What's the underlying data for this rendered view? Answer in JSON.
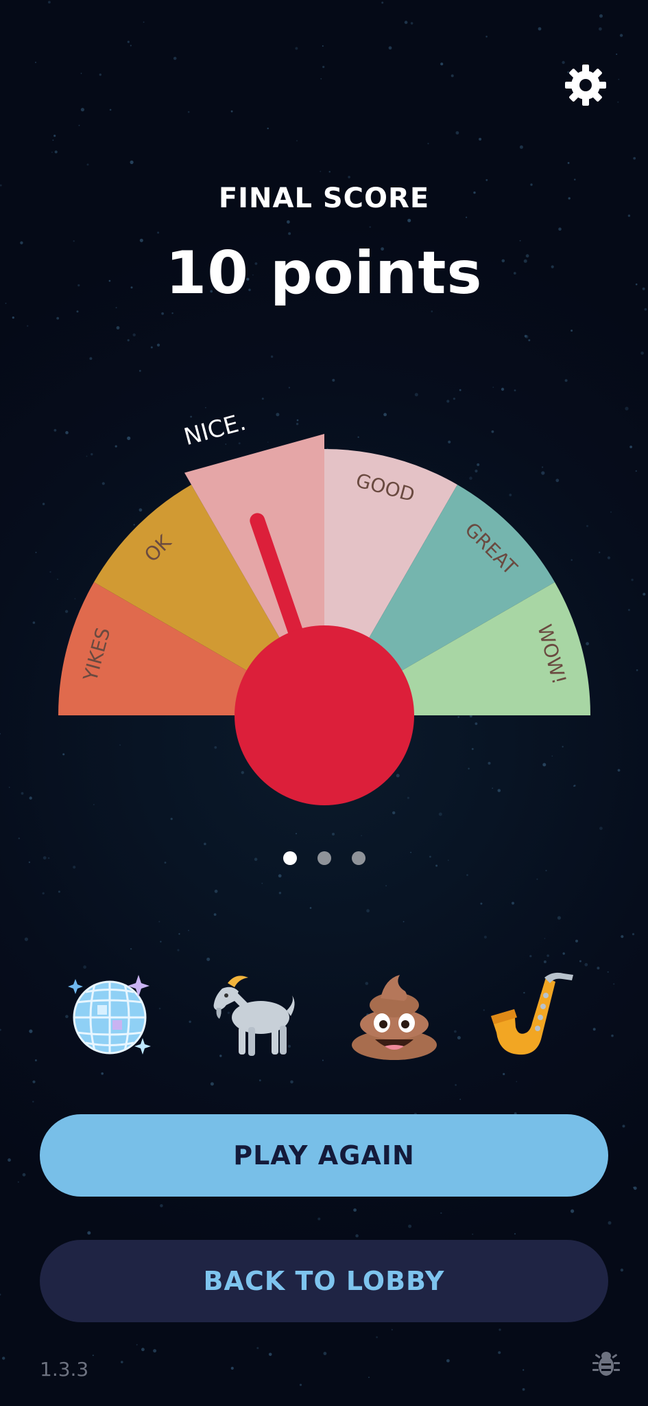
{
  "header": {
    "settings_icon": "gear-icon",
    "score_label": "FINAL SCORE",
    "score_value": "10 points"
  },
  "gauge": {
    "segments": [
      {
        "label": "YIKES",
        "color": "#e06a4d"
      },
      {
        "label": "OK",
        "color": "#d19a33"
      },
      {
        "label": "NICE.",
        "color": "#e5a6a7",
        "highlighted": true
      },
      {
        "label": "GOOD",
        "color": "#e4c2c6"
      },
      {
        "label": "GREAT",
        "color": "#75b5ae"
      },
      {
        "label": "WOW!",
        "color": "#a8d6a4"
      }
    ],
    "selected": "NICE.",
    "needle_color": "#dc1f3a"
  },
  "pagination": {
    "count": 3,
    "active_index": 0
  },
  "reactions": [
    "disco-ball",
    "goat",
    "poop",
    "saxophone"
  ],
  "buttons": {
    "play_again": "PLAY AGAIN",
    "back_to_lobby": "BACK TO LOBBY"
  },
  "footer": {
    "version": "1.3.3",
    "bug_icon": "bug-icon"
  },
  "colors": {
    "background": "#050a17",
    "primary_button": "#78bfe8",
    "secondary_button": "#1f2444",
    "secondary_text": "#7ec4ee"
  }
}
